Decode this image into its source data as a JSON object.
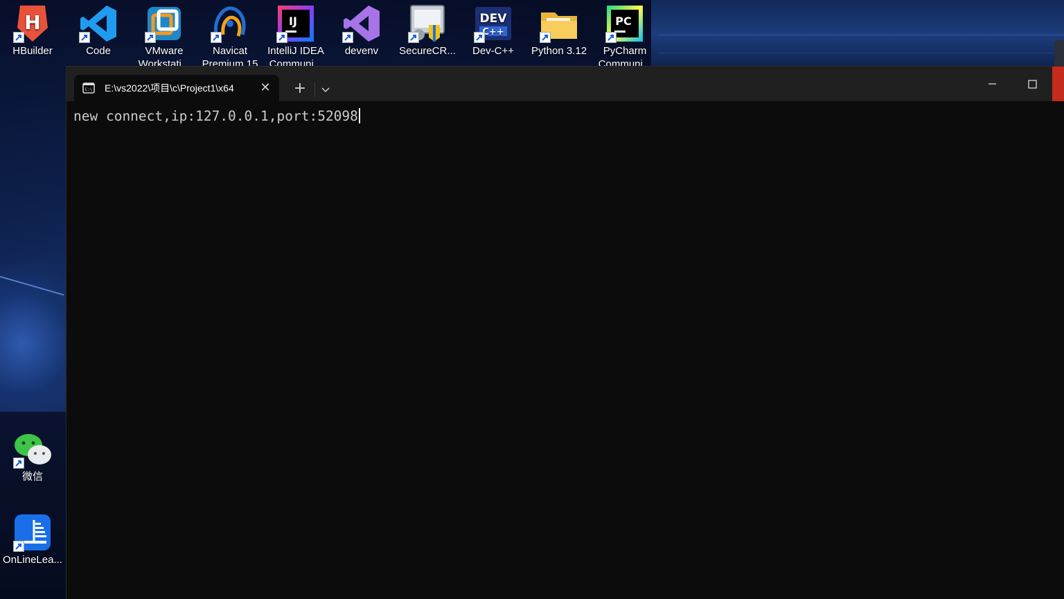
{
  "desktop": {
    "top_icons": [
      {
        "label": "HBuilder",
        "label2": "",
        "icon": "hbuilder-icon"
      },
      {
        "label": "Code",
        "label2": "",
        "icon": "vscode-icon"
      },
      {
        "label": "VMware",
        "label2": "Workstati...",
        "icon": "vmware-icon"
      },
      {
        "label": "Navicat",
        "label2": "Premium 15",
        "icon": "navicat-icon"
      },
      {
        "label": "IntelliJ IDEA",
        "label2": "Communi...",
        "icon": "intellij-icon"
      },
      {
        "label": "devenv",
        "label2": "",
        "icon": "visual-studio-icon"
      },
      {
        "label": "SecureCR...",
        "label2": "",
        "icon": "securecrt-icon"
      },
      {
        "label": "Dev-C++",
        "label2": "",
        "icon": "devcpp-icon"
      },
      {
        "label": "Python 3.12",
        "label2": "",
        "icon": "folder-icon"
      },
      {
        "label": "PyCharm",
        "label2": "Communi...",
        "icon": "pycharm-icon"
      }
    ],
    "left_icons": [
      {
        "label": "微信",
        "icon": "wechat-icon"
      },
      {
        "label": "OnLineLea...",
        "icon": "onlinelearning-icon"
      }
    ]
  },
  "terminal": {
    "tab_title": "E:\\vs2022\\项目\\c\\Project1\\x64",
    "tab_close": "✕",
    "new_tab": "+",
    "output": "new connect,ip:127.0.0.1,port:52098"
  },
  "colors": {
    "terminal_bg": "#0c0c0c",
    "titlebar_bg": "#202020",
    "text": "#cccccc",
    "close_red": "#c42b1c"
  }
}
